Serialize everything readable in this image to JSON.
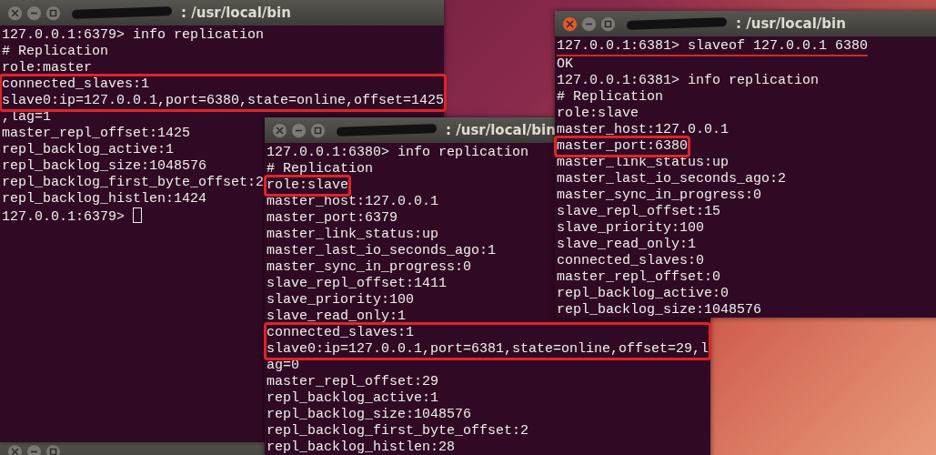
{
  "windows": [
    {
      "title": ": /usr/local/bin",
      "active": false,
      "lines": [
        {
          "text": "127.0.0.1:6379> info replication"
        },
        {
          "text": "# Replication"
        },
        {
          "text": "role:master"
        },
        {
          "text": "connected_slaves:1",
          "boxed": true
        },
        {
          "text": "slave0:ip=127.0.0.1,port=6380,state=online,offset=1425",
          "boxed": true
        },
        {
          "text": ",lag=1"
        },
        {
          "text": "master_repl_offset:1425"
        },
        {
          "text": "repl_backlog_active:1"
        },
        {
          "text": "repl_backlog_size:1048576"
        },
        {
          "text": "repl_backlog_first_byte_offset:2"
        },
        {
          "text": "repl_backlog_histlen:1424"
        },
        {
          "text": "127.0.0.1:6379> ",
          "cursor": true
        }
      ]
    },
    {
      "title": ": /usr/local/bin",
      "active": false,
      "lines": [
        {
          "text": "127.0.0.1:6380> info replication"
        },
        {
          "text": "# Replication"
        },
        {
          "text": "role:slave",
          "boxed": true
        },
        {
          "text": "master_host:127.0.0.1"
        },
        {
          "text": "master_port:6379"
        },
        {
          "text": "master_link_status:up"
        },
        {
          "text": "master_last_io_seconds_ago:1"
        },
        {
          "text": "master_sync_in_progress:0"
        },
        {
          "text": "slave_repl_offset:1411"
        },
        {
          "text": "slave_priority:100"
        },
        {
          "text": "slave_read_only:1"
        },
        {
          "text": "connected_slaves:1",
          "boxed": true
        },
        {
          "text": "slave0:ip=127.0.0.1,port=6381,state=online,offset=29,l",
          "boxed": true
        },
        {
          "text": "ag=0"
        },
        {
          "text": "master_repl_offset:29"
        },
        {
          "text": "repl_backlog_active:1"
        },
        {
          "text": "repl_backlog_size:1048576"
        },
        {
          "text": "repl_backlog_first_byte_offset:2"
        },
        {
          "text": "repl_backlog_histlen:28"
        }
      ]
    },
    {
      "title": ": /usr/local/bin",
      "active": true,
      "lines": [
        {
          "text": "127.0.0.1:6381> slaveof 127.0.0.1 6380",
          "underlined": true
        },
        {
          "text": "OK"
        },
        {
          "text": "127.0.0.1:6381> info replication"
        },
        {
          "text": "# Replication"
        },
        {
          "text": "role:slave"
        },
        {
          "text": "master_host:127.0.0.1"
        },
        {
          "text": "master_port:6380",
          "boxed": true
        },
        {
          "text": "master_link_status:up"
        },
        {
          "text": "master_last_io_seconds_ago:2"
        },
        {
          "text": "master_sync_in_progress:0"
        },
        {
          "text": "slave_repl_offset:15"
        },
        {
          "text": "slave_priority:100"
        },
        {
          "text": "slave_read_only:1"
        },
        {
          "text": "connected_slaves:0"
        },
        {
          "text": "master_repl_offset:0"
        },
        {
          "text": "repl_backlog_active:0"
        },
        {
          "text": "repl_backlog_size:1048576"
        }
      ]
    }
  ]
}
